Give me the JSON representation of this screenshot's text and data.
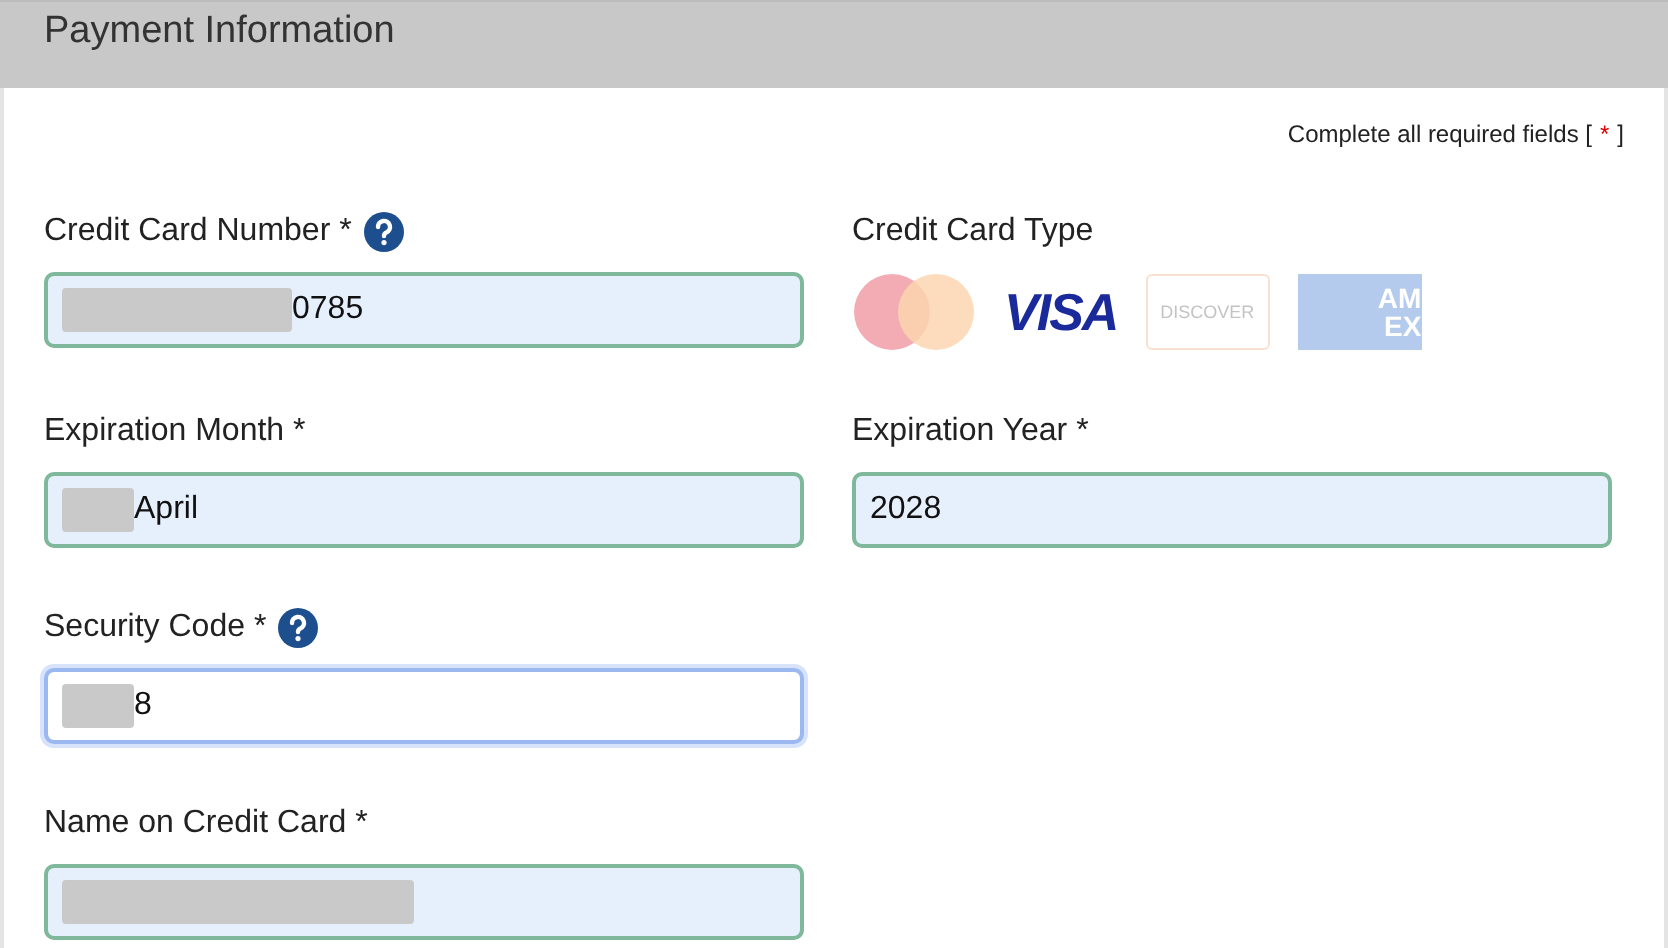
{
  "header": {
    "title": "Payment Information"
  },
  "required_note": {
    "before": "Complete all required fields [",
    "mark": "*",
    "after": "]"
  },
  "card_type": {
    "label": "Credit Card Type",
    "cards": [
      {
        "kind": "mastercard",
        "selected": false
      },
      {
        "kind": "visa",
        "text": "VISA",
        "selected": true
      },
      {
        "kind": "discover",
        "text": "DISCOVER",
        "selected": false
      },
      {
        "kind": "amex",
        "lines": [
          "AM",
          "EX"
        ],
        "selected": false
      }
    ]
  },
  "fields": [
    {
      "label": "Credit Card Number *",
      "help": true,
      "value": "0785",
      "redacted": true,
      "focused": false
    },
    {
      "label": "Expiration Month *",
      "help": false,
      "value": "April",
      "redacted": true,
      "focused": false
    },
    {
      "label": "Expiration Year *",
      "help": false,
      "value": "2028",
      "redacted": false,
      "focused": false
    },
    {
      "label": "Security Code *",
      "help": true,
      "value": "8",
      "redacted": true,
      "focused": true
    },
    {
      "label": "Name on Credit Card *",
      "help": false,
      "redacted": true,
      "focused": false
    }
  ]
}
